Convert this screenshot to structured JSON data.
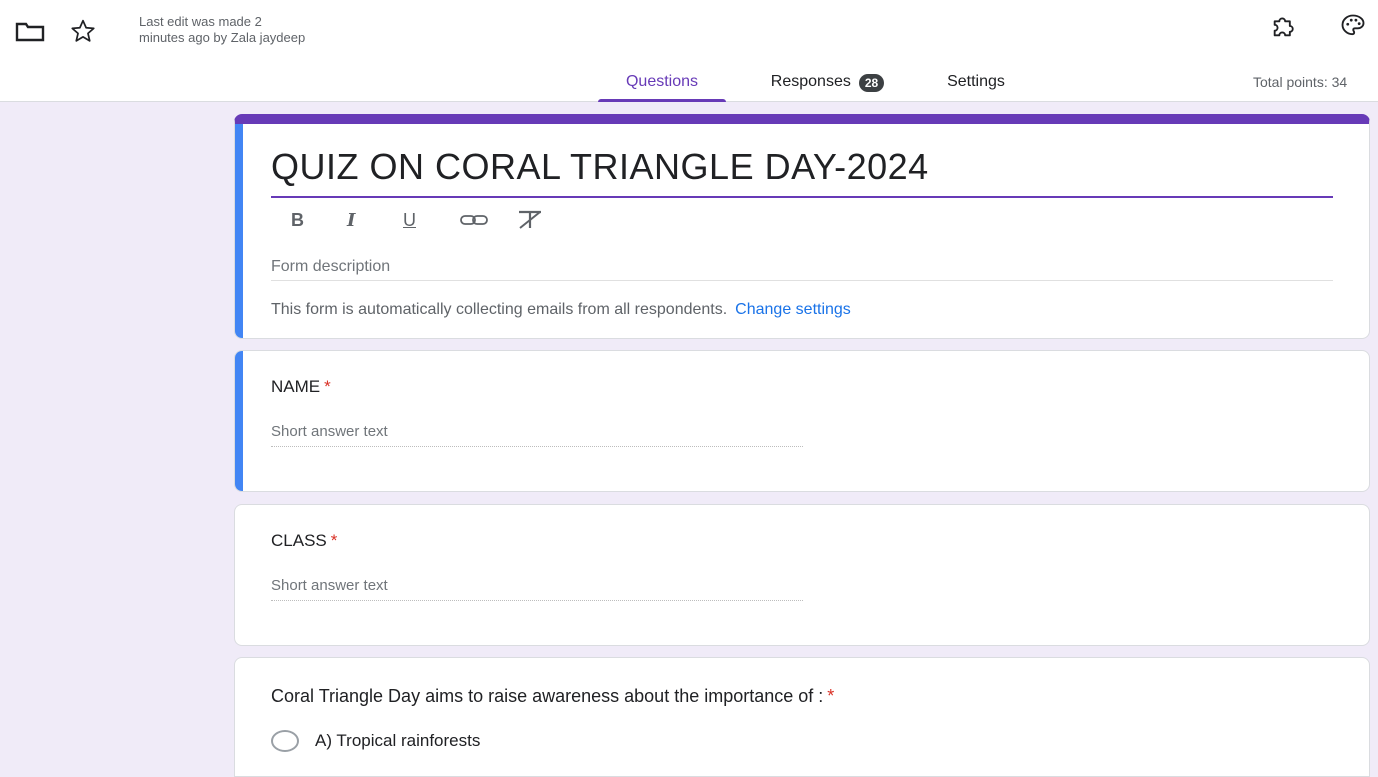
{
  "header": {
    "last_edit": "Last edit was made 2\nminutes ago by Zala jaydeep",
    "tabs": [
      {
        "label": "Questions",
        "active": true
      },
      {
        "label": "Responses",
        "count": "28",
        "active": false
      },
      {
        "label": "Settings",
        "active": false
      }
    ],
    "total_points": "Total points: 34"
  },
  "icons": {
    "folder": "folder-icon",
    "star": "star-icon",
    "addons": "puzzle-icon",
    "theme": "palette-icon"
  },
  "form": {
    "title": "QUIZ ON CORAL TRIANGLE DAY-2024",
    "format_buttons": [
      "B",
      "I",
      "U"
    ],
    "description_placeholder": "Form description",
    "collect_note": "This form is automatically collecting emails from all respondents.",
    "change_settings": "Change settings"
  },
  "questions": [
    {
      "title": "NAME",
      "required": "*",
      "placeholder": "Short answer text"
    },
    {
      "title": "CLASS",
      "required": "*",
      "placeholder": "Short answer text"
    },
    {
      "title": "Coral Triangle Day aims to raise awareness about the importance of :",
      "required": "*",
      "options": [
        "A) Tropical rainforests"
      ]
    }
  ],
  "colors": {
    "accent": "#673ab7",
    "focus": "#4285f4",
    "link": "#1a73e8",
    "required": "#d93025",
    "background": "#f0ebf8"
  }
}
